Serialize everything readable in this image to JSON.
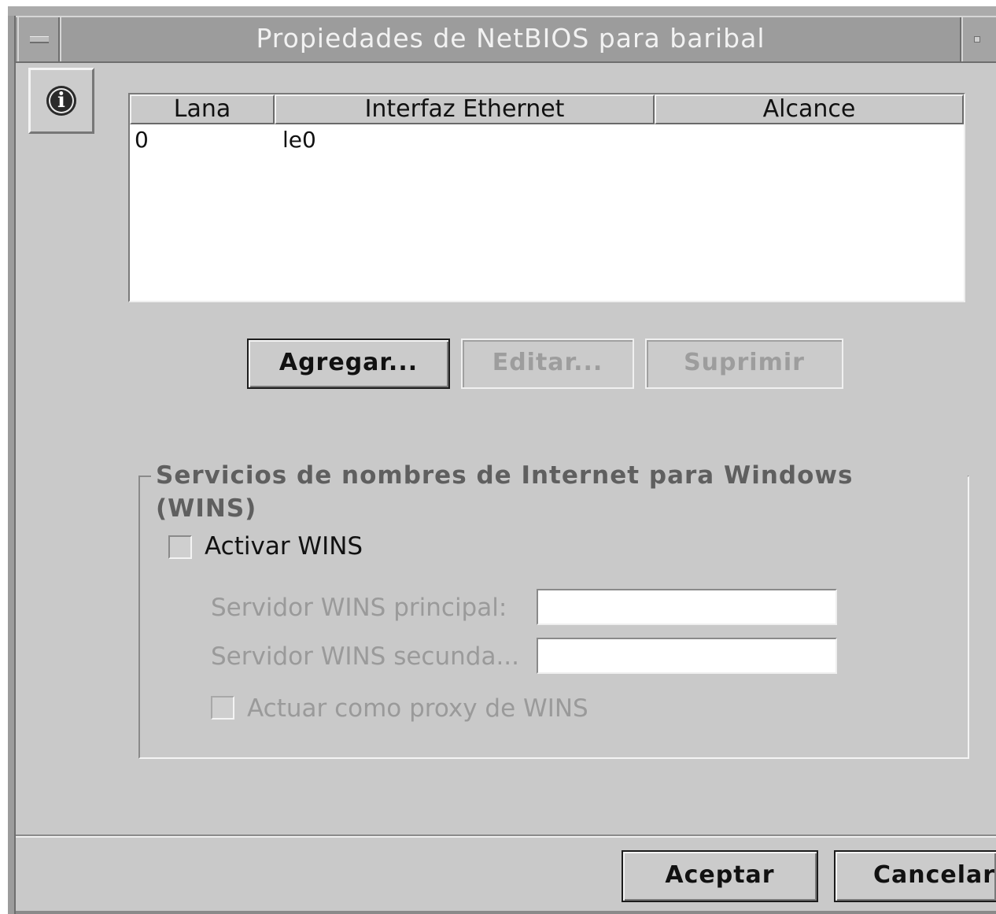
{
  "window": {
    "title": "Propiedades de NetBIOS para baribal"
  },
  "table": {
    "columns": [
      "Lana",
      "Interfaz Ethernet",
      "Alcance"
    ],
    "rows": [
      [
        "0",
        "le0",
        ""
      ]
    ]
  },
  "actions": {
    "add_label": "Agregar...",
    "edit_label": "Editar...",
    "delete_label": "Suprimir"
  },
  "wins": {
    "group_title": "Servicios de nombres de Internet para Windows (WINS)",
    "enable_label": "Activar WINS",
    "enable_checked": false,
    "primary_label": "Servidor WINS principal:",
    "primary_value": "",
    "secondary_label": "Servidor WINS secunda...",
    "secondary_value": "",
    "proxy_label": "Actuar como proxy de WINS",
    "proxy_checked": false
  },
  "footer": {
    "ok_label": "Aceptar",
    "cancel_label": "Cancelar"
  },
  "icons": {
    "info": "info-icon"
  },
  "info_glyph": "i"
}
